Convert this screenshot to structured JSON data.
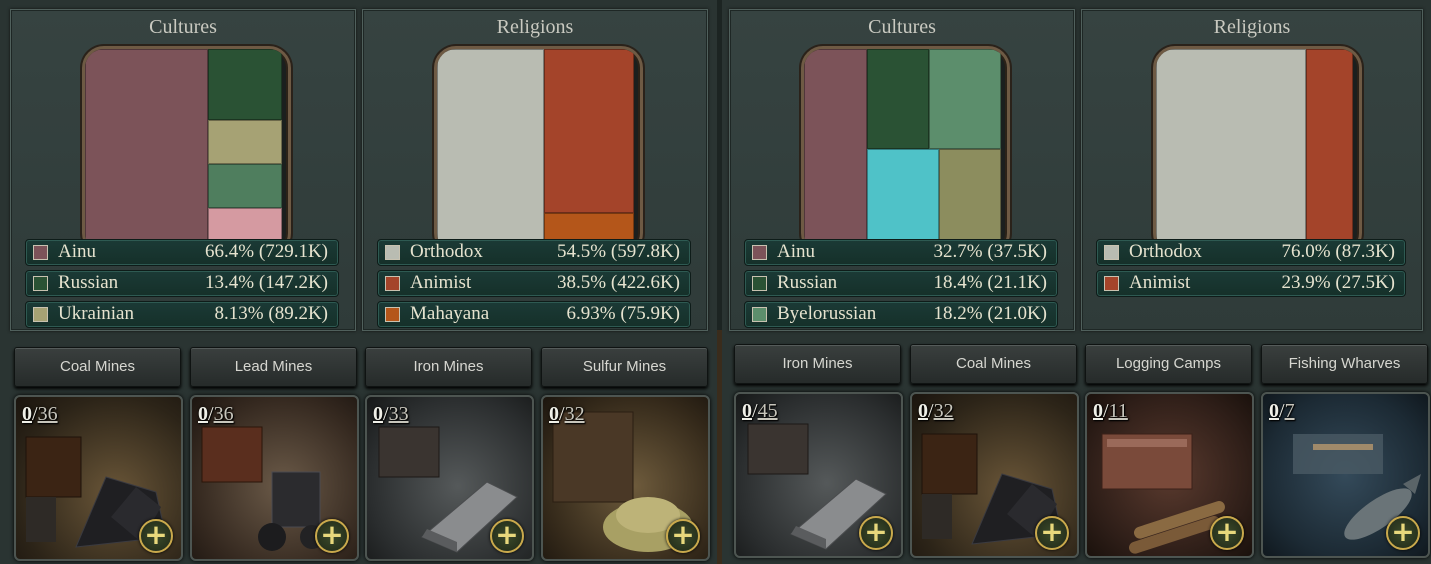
{
  "colors": {
    "ainu": "#7c5359",
    "russian": "#2a5234",
    "ukrainian": "#a6a274",
    "byelorussian": "#5c8e6c",
    "small_culture": "#d59aa1",
    "cyan_culture": "#4fc2c8",
    "olive_culture": "#8c8d5e",
    "orthodox": "#b9bcb2",
    "animist": "#a4442a",
    "mahayana": "#b4561a"
  },
  "left": {
    "cultures": {
      "title": "Cultures",
      "items": [
        {
          "name": "Ainu",
          "value": "66.4% (729.1K)",
          "color": "#7c5359"
        },
        {
          "name": "Russian",
          "value": "13.4% (147.2K)",
          "color": "#2a5234"
        },
        {
          "name": "Ukrainian",
          "value": "8.13% (89.2K)",
          "color": "#a6a274"
        }
      ]
    },
    "religions": {
      "title": "Religions",
      "items": [
        {
          "name": "Orthodox",
          "value": "54.5% (597.8K)",
          "color": "#b9bcb2"
        },
        {
          "name": "Animist",
          "value": "38.5% (422.6K)",
          "color": "#a4442a"
        },
        {
          "name": "Mahayana",
          "value": "6.93% (75.9K)",
          "color": "#b4561a"
        }
      ]
    },
    "buildings": [
      {
        "name": "Coal Mines",
        "count": "0",
        "max": "36",
        "icon": "coal-icon"
      },
      {
        "name": "Lead Mines",
        "count": "0",
        "max": "36",
        "icon": "lead-icon"
      },
      {
        "name": "Iron Mines",
        "count": "0",
        "max": "33",
        "icon": "iron-icon"
      },
      {
        "name": "Sulfur Mines",
        "count": "0",
        "max": "32",
        "icon": "sulfur-icon"
      }
    ]
  },
  "right": {
    "cultures": {
      "title": "Cultures",
      "items": [
        {
          "name": "Ainu",
          "value": "32.7% (37.5K)",
          "color": "#7c5359"
        },
        {
          "name": "Russian",
          "value": "18.4% (21.1K)",
          "color": "#2a5234"
        },
        {
          "name": "Byelorussian",
          "value": "18.2% (21.0K)",
          "color": "#5c8e6c"
        }
      ]
    },
    "religions": {
      "title": "Religions",
      "items": [
        {
          "name": "Orthodox",
          "value": "76.0% (87.3K)",
          "color": "#b9bcb2"
        },
        {
          "name": "Animist",
          "value": "23.9% (27.5K)",
          "color": "#a4442a"
        }
      ]
    },
    "buildings": [
      {
        "name": "Iron Mines",
        "count": "0",
        "max": "45",
        "icon": "iron-icon"
      },
      {
        "name": "Coal Mines",
        "count": "0",
        "max": "32",
        "icon": "coal-icon"
      },
      {
        "name": "Logging Camps",
        "count": "0",
        "max": "11",
        "icon": "logging-icon"
      },
      {
        "name": "Fishing Wharves",
        "count": "0",
        "max": "7",
        "icon": "fishing-icon"
      }
    ]
  },
  "add_symbol": "+"
}
